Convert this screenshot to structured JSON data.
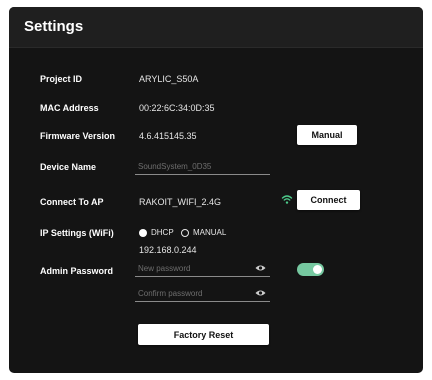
{
  "settings": {
    "title": "Settings",
    "project_id": {
      "label": "Project ID",
      "value": "ARYLIC_S50A"
    },
    "mac_address": {
      "label": "MAC Address",
      "value": "00:22:6C:34:0D:35"
    },
    "firmware": {
      "label": "Firmware Version",
      "value": "4.6.415145.35",
      "button": "Manual"
    },
    "device_name": {
      "label": "Device Name",
      "placeholder": "SoundSystem_0D35"
    },
    "connect_ap": {
      "label": "Connect To AP",
      "value": "RAKOIT_WIFI_2.4G",
      "button": "Connect",
      "icon": "wifi-icon"
    },
    "ip_settings": {
      "label": "IP Settings (WiFi)",
      "options": [
        "DHCP",
        "MANUAL"
      ],
      "selected": "DHCP",
      "ip": "192.168.0.244"
    },
    "admin_password": {
      "label": "Admin Password",
      "new_placeholder": "New password",
      "confirm_placeholder": "Confirm password",
      "toggle_on": true
    },
    "factory_reset": "Factory Reset"
  },
  "colors": {
    "panel": "#141414",
    "header": "#1f1f1f",
    "wifi": "#4cc98a",
    "toggle": "#76c8a0"
  }
}
